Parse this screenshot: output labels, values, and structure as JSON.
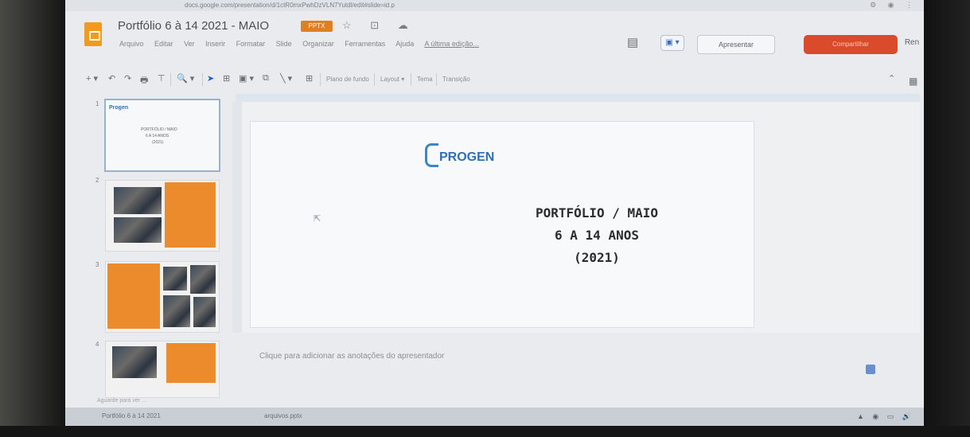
{
  "browser": {
    "url": "docs.google.com/presentation/d/1ctR0mxPwhDzVLN7Yutdl/edit#slide=id.p",
    "extensions": "⚙ ◉ ⋮"
  },
  "doc": {
    "title": "Portfólio 6 à 14 2021 - MAIO",
    "badge": "PPTX",
    "title_icons": "☆ ⊡ ☁"
  },
  "menu": {
    "items": [
      "Arquivo",
      "Editar",
      "Ver",
      "Inserir",
      "Formatar",
      "Slide",
      "Organizar",
      "Ferramentas",
      "Ajuda"
    ],
    "last_edit": "A última edição..."
  },
  "header": {
    "comments_icon": "▤",
    "camera_icon": "▣ ▾",
    "present_label": "Apresentar",
    "share_label": "Compartilhar",
    "avatar": "Ren"
  },
  "toolbar": {
    "new_slide": "+ ▾",
    "undo": "↶",
    "redo": "↷",
    "print": "🖶",
    "paint": "⊤",
    "zoom": "🔍 ▾",
    "select": "➤",
    "textbox": "⊞",
    "image": "▣ ▾",
    "shape": "⧉",
    "line": "╲ ▾",
    "comment": "⊞",
    "background": "Plano de fundo",
    "layout": "Layout ▾",
    "theme": "Tema",
    "transition": "Transição",
    "collapse": "⌃"
  },
  "right_rail": {
    "calendar": "▦",
    "keep": "◧",
    "tasks": "●",
    "expand": "›"
  },
  "slides": [
    {
      "num": "1",
      "logo": "Progen",
      "lines": [
        "PORTFÓLIO / MAIO",
        "6 A 14 ANOS",
        "(2021)"
      ]
    },
    {
      "num": "2"
    },
    {
      "num": "3"
    },
    {
      "num": "4"
    }
  ],
  "slide": {
    "logo": "PROGEN",
    "title_line1": "PORTFÓLIO / MAIO",
    "title_line2": "6 A 14 ANOS",
    "title_line3": "(2021)"
  },
  "notes_placeholder": "Clique para adicionar as anotações do apresentador",
  "status_left": "Aguarde para ver ...",
  "taskbar": {
    "left1": "Portfólio 6 à 14 2021",
    "left2": "arquivos.pptx",
    "tray": "▲ ◉ ▭ 🔊"
  },
  "colors": {
    "accent_orange": "#eb8b2c",
    "share_red": "#d94b2b",
    "brand_blue": "#2f6fb7"
  }
}
